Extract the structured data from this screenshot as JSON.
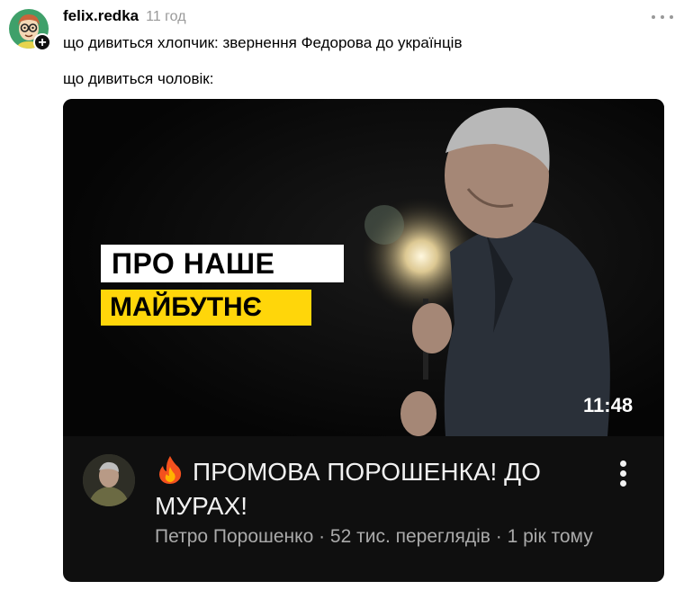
{
  "post": {
    "username": "felix.redka",
    "time": "11 год",
    "follow_symbol": "+",
    "text_line1": "що дивиться хлопчик: звернення Федорова до українців",
    "text_line2": "що дивиться чоловік:"
  },
  "video": {
    "overlay_line1": "ПРО НАШЕ",
    "overlay_line2": "МАЙБУТНЄ",
    "duration": "11:48",
    "title": "ПРОМОВА ПОРОШЕНКА! ДО МУРАХ!",
    "meta": "Петро Порошенко · 52 тис. переглядів · 1 рік тому",
    "title_icon": "fire-icon"
  },
  "colors": {
    "card_bg": "#0f0f0f",
    "overlay_yellow": "#ffd60a",
    "avatar_green": "#3fa06a",
    "meta_gray": "#aaaaaa"
  }
}
